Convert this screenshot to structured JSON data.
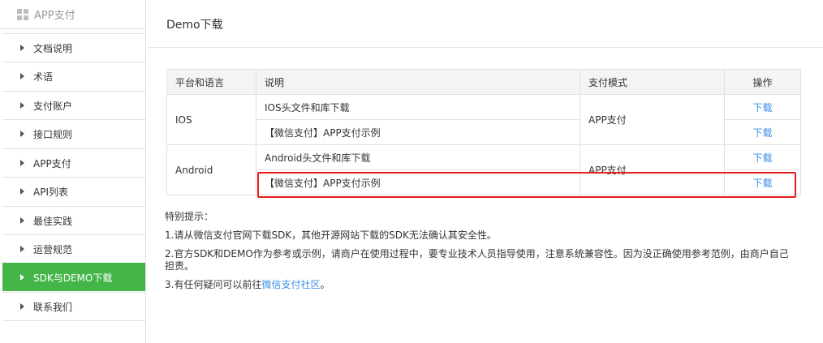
{
  "sidebar": {
    "header": "APP支付",
    "items": [
      {
        "label": "文档说明",
        "active": false
      },
      {
        "label": "术语",
        "active": false
      },
      {
        "label": "支付账户",
        "active": false
      },
      {
        "label": "接口规则",
        "active": false
      },
      {
        "label": "APP支付",
        "active": false
      },
      {
        "label": "API列表",
        "active": false
      },
      {
        "label": "最佳实践",
        "active": false
      },
      {
        "label": "运营规范",
        "active": false
      },
      {
        "label": "SDK与DEMO下载",
        "active": true
      },
      {
        "label": "联系我们",
        "active": false
      }
    ]
  },
  "main": {
    "title": "Demo下载",
    "table": {
      "headers": [
        "平台和语言",
        "说明",
        "支付模式",
        "操作"
      ],
      "groups": [
        {
          "platform": "IOS",
          "mode": "APP支付",
          "rows": [
            {
              "desc": "IOS头文件和库下载",
              "action": "下载"
            },
            {
              "desc": "【微信支付】APP支付示例",
              "action": "下载"
            }
          ]
        },
        {
          "platform": "Android",
          "mode": "APP支付",
          "rows": [
            {
              "desc": "Android头文件和库下载",
              "action": "下载"
            },
            {
              "desc": "【微信支付】APP支付示例",
              "action": "下载"
            }
          ]
        }
      ]
    },
    "notes": {
      "heading": "特别提示：",
      "line1": "1.请从微信支付官网下载SDK，其他开源网站下载的SDK无法确认其安全性。",
      "line2": "2.官方SDK和DEMO作为参考或示例，请商户在使用过程中，要专业技术人员指导使用，注意系统兼容性。因为没正确使用参考范例，由商户自己担责。",
      "line3_prefix": "3.有任何疑问可以前往",
      "line3_link": "微信支付社区",
      "line3_suffix": "。"
    }
  },
  "colors": {
    "accent_green": "#44b549",
    "link_blue": "#3a8ee6",
    "highlight_red": "#e61e1e"
  }
}
